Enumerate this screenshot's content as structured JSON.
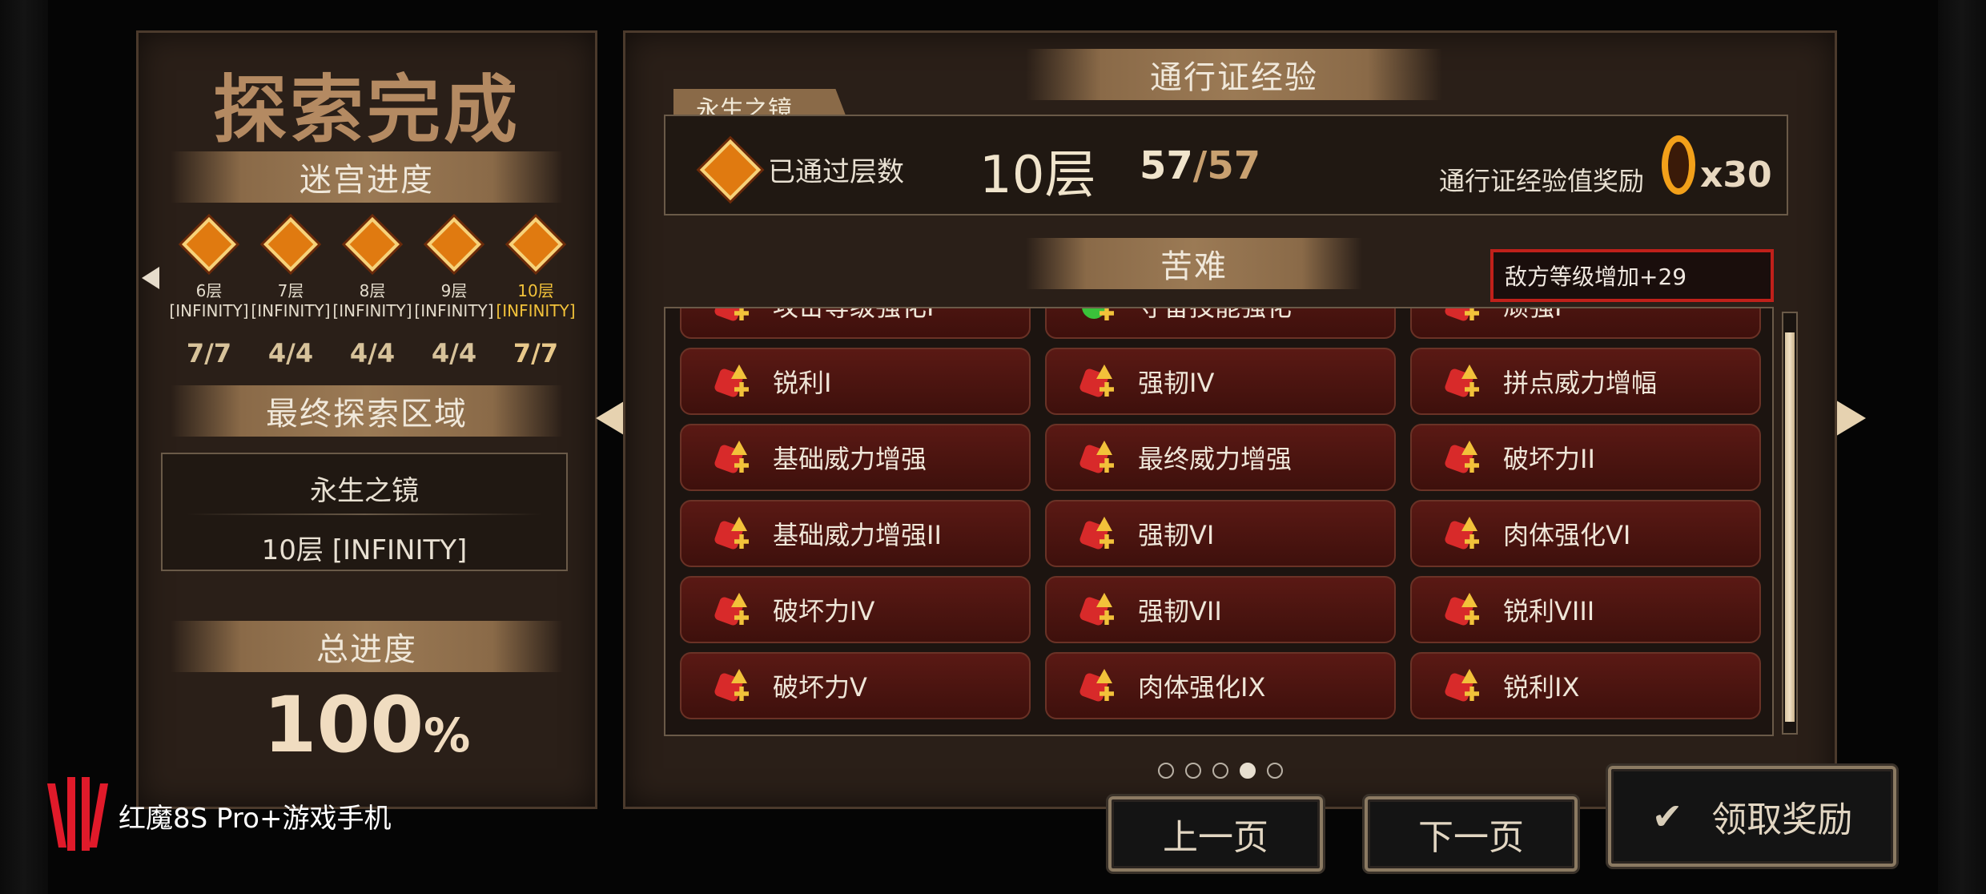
{
  "left_panel": {
    "title": "探索完成",
    "maze_progress_label": "迷宫进度",
    "stages": [
      {
        "level": "6层",
        "tag": "[INFINITY]",
        "count": "7/7",
        "active": false
      },
      {
        "level": "7层",
        "tag": "[INFINITY]",
        "count": "4/4",
        "active": false
      },
      {
        "level": "8层",
        "tag": "[INFINITY]",
        "count": "4/4",
        "active": false
      },
      {
        "level": "9层",
        "tag": "[INFINITY]",
        "count": "4/4",
        "active": false
      },
      {
        "level": "10层",
        "tag": "[INFINITY]",
        "count": "7/7",
        "active": true
      }
    ],
    "final_area_label": "最终探索区域",
    "final_area_name": "永生之镜",
    "final_area_floor": "10层 [INFINITY]",
    "total_progress_label": "总进度",
    "total_progress_value": "100",
    "total_progress_unit": "%"
  },
  "right_panel": {
    "pass_exp_title": "通行证经验",
    "location_tab": "永生之镜",
    "floors_passed_label": "已通过层数",
    "floors_value": "10层",
    "floors_current": "57",
    "floors_total": "/57",
    "exp_reward_label": "通行证经验值奖励",
    "exp_reward_multiplier": "x30",
    "hardship_title": "苦难",
    "enemy_level_badge": "敌方等级增加+29",
    "skills": [
      {
        "label": "攻击等级强化I",
        "icon": "attack-up-icon"
      },
      {
        "label": "守备技能强化",
        "icon": "defense-skill-icon"
      },
      {
        "label": "顽强I",
        "icon": "tenacity-icon"
      },
      {
        "label": "锐利I",
        "icon": "sharpness-icon"
      },
      {
        "label": "强韧IV",
        "icon": "toughness-icon"
      },
      {
        "label": "拼点威力增幅",
        "icon": "clash-power-icon"
      },
      {
        "label": "基础威力增强",
        "icon": "base-power-icon"
      },
      {
        "label": "最终威力增强",
        "icon": "final-power-icon"
      },
      {
        "label": "破坏力II",
        "icon": "destruction-icon"
      },
      {
        "label": "基础威力增强II",
        "icon": "base-power-icon"
      },
      {
        "label": "强韧VI",
        "icon": "toughness-icon"
      },
      {
        "label": "肉体强化VI",
        "icon": "body-boost-icon"
      },
      {
        "label": "破坏力IV",
        "icon": "destruction-icon"
      },
      {
        "label": "强韧VII",
        "icon": "toughness-icon"
      },
      {
        "label": "锐利VIII",
        "icon": "sharpness-icon"
      },
      {
        "label": "破坏力V",
        "icon": "destruction-icon"
      },
      {
        "label": "肉体强化IX",
        "icon": "body-boost-icon"
      },
      {
        "label": "锐利IX",
        "icon": "sharpness-icon"
      }
    ],
    "page_dots": 5,
    "current_page_dot": 4
  },
  "buttons": {
    "prev_page": "上一页",
    "next_page": "下一页",
    "claim_reward": "领取奖励"
  },
  "watermark": {
    "text": "红魔8S Pro+游戏手机"
  },
  "colors": {
    "panel_bg": "#2a1f18",
    "skill_bg": "#4a1510",
    "accent_gold": "#f2c23a",
    "badge_border": "#c0201a"
  }
}
